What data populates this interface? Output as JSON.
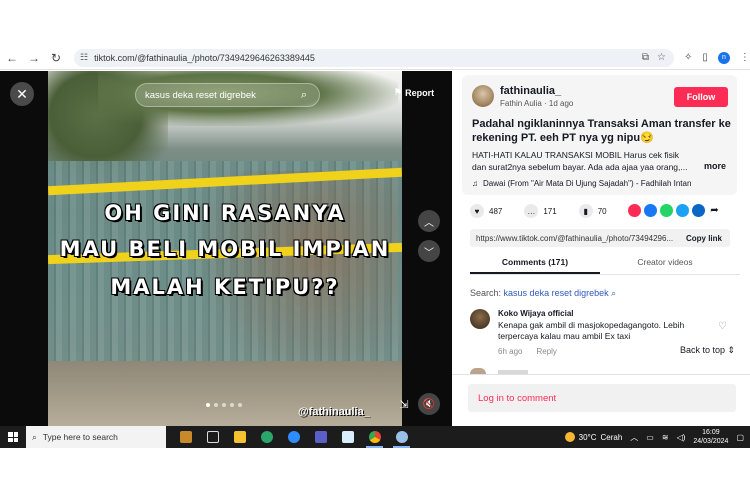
{
  "browser": {
    "url": "tiktok.com/@fathinaulia_/photo/7349429646263389445",
    "profile_initial": "n"
  },
  "video": {
    "search_text": "kasus deka reset digrebek",
    "report_label": "Report",
    "overlay_lines": [
      "OH GINI RASANYA",
      "MAU BELI MOBIL IMPIAN",
      "MALAH KETIPU??"
    ],
    "watermark": "@fathinaulia_"
  },
  "post": {
    "username": "fathinaulia_",
    "display_name": "Fathin Aulia",
    "time_ago": "1d ago",
    "subline": "Fathin Aulia · 1d ago",
    "follow_label": "Follow",
    "caption": "Padahal ngiklaninnya Transaksi Aman transfer ke rekening PT. eeh PT nya yg nipu😏",
    "description": "HATI-HATI KALAU TRANSAKSI MOBIL Harus cek fisik dan surat2nya sebelum bayar. Ada ada ajaa yaa orang,...",
    "more_label": "more",
    "music": "Dawai (From \"Air Mata Di Ujung Sajadah\") - Fadhilah Intan",
    "likes": "487",
    "comments": "171",
    "saves": "70",
    "link": "https://www.tiktok.com/@fathinaulia_/photo/73494296...",
    "copy_label": "Copy link"
  },
  "tabs": [
    {
      "label": "Comments (171)",
      "active": true
    },
    {
      "label": "Creator videos",
      "active": false
    }
  ],
  "comments_section": {
    "search_prefix": "Search:",
    "search_keyword": "kasus deka reset digrebek",
    "first_comment": {
      "name": "Koko Wijaya official",
      "text": "Kenapa gak ambil di masjokopedagangoto. Lebih terpercaya kalau mau ambil Ex taxi",
      "time": "6h ago",
      "reply_label": "Reply"
    },
    "back_to_top": "Back to top",
    "login_label": "Log in to comment"
  },
  "taskbar": {
    "search_placeholder": "Type here to search",
    "temperature": "30°C",
    "weather": "Cerah",
    "time": "16:09",
    "date": "24/03/2024"
  },
  "colors": {
    "accent": "#fe2c55",
    "tape": "#f1d21a",
    "link_keyword": "#2f5bbd"
  }
}
